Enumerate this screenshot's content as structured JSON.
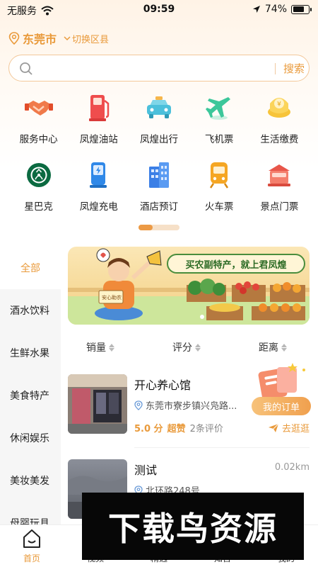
{
  "status_bar": {
    "carrier": "无服务",
    "time": "09:59",
    "battery": "74%",
    "battery_level": 0.74
  },
  "location": {
    "city": "东莞市",
    "switch_label": "切换区县"
  },
  "search": {
    "placeholder": "",
    "button_label": "搜索"
  },
  "services": [
    {
      "label": "服务中心",
      "icon": "handshake-icon"
    },
    {
      "label": "凤煌油站",
      "icon": "fuel-pump-icon"
    },
    {
      "label": "凤煌出行",
      "icon": "taxi-icon"
    },
    {
      "label": "飞机票",
      "icon": "airplane-icon"
    },
    {
      "label": "生活缴费",
      "icon": "coin-icon"
    },
    {
      "label": "星巴克",
      "icon": "starbucks-logo-icon"
    },
    {
      "label": "凤煌充电",
      "icon": "charging-icon"
    },
    {
      "label": "酒店预订",
      "icon": "hotel-building-icon"
    },
    {
      "label": "火车票",
      "icon": "train-icon"
    },
    {
      "label": "景点门票",
      "icon": "scenic-spot-icon"
    }
  ],
  "categories": {
    "all_label": "全部",
    "items": [
      "酒水饮料",
      "生鲜水果",
      "美食特产",
      "休闲娱乐",
      "美妆美发",
      "母婴玩具"
    ]
  },
  "banner": {
    "title": "买农副特产，就上君凤煌",
    "sign": "安心助农"
  },
  "sort": {
    "sales": "销量",
    "rating": "评分",
    "distance": "距离"
  },
  "shops": [
    {
      "name": "开心养心馆",
      "distance": "",
      "address": "东莞市寮步镇兴凫路...",
      "score": "5.0 分",
      "grade": "超赞",
      "reviews": "2条评价",
      "go_label": "去逛逛"
    },
    {
      "name": "测试",
      "distance": "0.02km",
      "address": "北环路248号",
      "score": "",
      "grade": "",
      "reviews": "",
      "go_label": ""
    }
  ],
  "orders_button": "我的订单",
  "tabs": [
    {
      "label": "首页",
      "icon": "home-icon"
    },
    {
      "label": "视频",
      "icon": "video-icon"
    },
    {
      "label": "精选",
      "icon": "featured-icon"
    },
    {
      "label": "知否",
      "icon": "knowledge-icon"
    },
    {
      "label": "我的",
      "icon": "profile-icon"
    }
  ],
  "watermark": "下载鸟资源",
  "colors": {
    "accent": "#e99a3b",
    "search_border": "#f3c89a",
    "category_bg": "#f6f6f6"
  }
}
